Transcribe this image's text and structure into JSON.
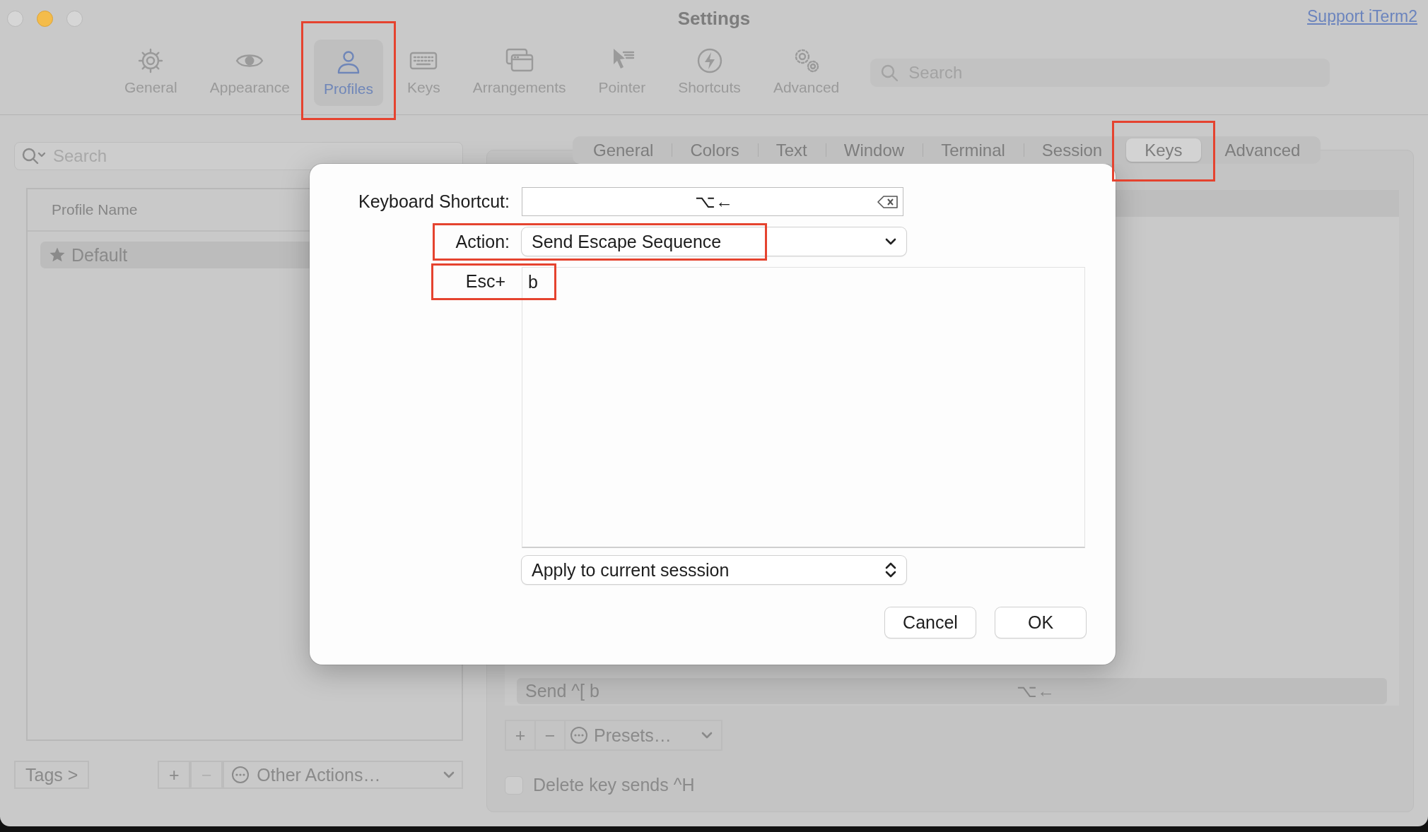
{
  "window": {
    "title": "Settings",
    "link": "Support iTerm2"
  },
  "toolbar": {
    "items": [
      {
        "label": "General",
        "selected": false,
        "highlighted": false
      },
      {
        "label": "Appearance",
        "selected": false,
        "highlighted": false
      },
      {
        "label": "Profiles",
        "selected": true,
        "highlighted": true
      },
      {
        "label": "Keys",
        "selected": false,
        "highlighted": false
      },
      {
        "label": "Arrangements",
        "selected": false,
        "highlighted": false
      },
      {
        "label": "Pointer",
        "selected": false,
        "highlighted": false
      },
      {
        "label": "Shortcuts",
        "selected": false,
        "highlighted": false
      },
      {
        "label": "Advanced",
        "selected": false,
        "highlighted": false
      }
    ],
    "search": {
      "placeholder": "Search"
    }
  },
  "profiles": {
    "search": {
      "placeholder": "Search"
    },
    "column": "Profile Name",
    "rows": [
      {
        "name": "Default",
        "default": true,
        "selected": true
      }
    ],
    "tags_button": "Tags >",
    "add": "+",
    "remove": {
      "label": "−",
      "disabled": true
    },
    "other_actions": "Other Actions…"
  },
  "editor": {
    "tabs": [
      {
        "label": "General",
        "selected": false,
        "highlighted": false
      },
      {
        "label": "Colors",
        "selected": false,
        "highlighted": false
      },
      {
        "label": "Text",
        "selected": false,
        "highlighted": false
      },
      {
        "label": "Window",
        "selected": false,
        "highlighted": false
      },
      {
        "label": "Terminal",
        "selected": false,
        "highlighted": false
      },
      {
        "label": "Session",
        "selected": false,
        "highlighted": false
      },
      {
        "label": "Keys",
        "selected": true,
        "highlighted": true
      },
      {
        "label": "Advanced",
        "selected": false,
        "highlighted": false
      }
    ],
    "key_rows": [
      {
        "action": "Send ^[ b",
        "shortcut": "⌥←",
        "selected": true
      }
    ],
    "add": "+",
    "remove": {
      "label": "−",
      "disabled": false
    },
    "presets": "Presets…",
    "delete_key": {
      "label": "Delete key sends ^H",
      "checked": false
    }
  },
  "dialog": {
    "shortcut_label": "Keyboard Shortcut:",
    "shortcut": "⌥←",
    "action_label": "Action:",
    "action": "Send Escape Sequence",
    "action_highlighted": true,
    "esc_label": "Esc+",
    "esc_value": "b",
    "esc_highlighted": true,
    "scope": "Apply to current sesssion",
    "buttons": [
      "Cancel",
      "OK"
    ]
  }
}
